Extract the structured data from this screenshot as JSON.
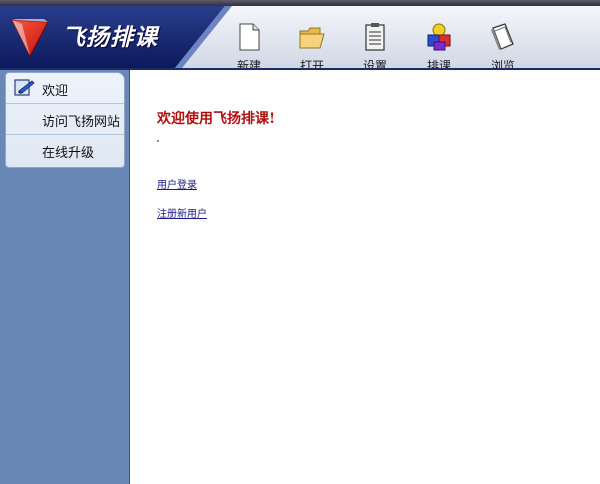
{
  "app": {
    "brand_name": "飞扬排课"
  },
  "toolbar": {
    "buttons": [
      {
        "label": "新建",
        "icon": "new-file-icon"
      },
      {
        "label": "打开",
        "icon": "open-folder-icon"
      },
      {
        "label": "设置",
        "icon": "settings-clipboard-icon"
      },
      {
        "label": "排课",
        "icon": "schedule-blocks-icon"
      },
      {
        "label": "浏览",
        "icon": "browse-book-icon"
      }
    ]
  },
  "sidebar": {
    "items": [
      {
        "label": "欢迎",
        "icon": "welcome-icon"
      },
      {
        "label": "访问飞扬网站"
      },
      {
        "label": "在线升级"
      }
    ]
  },
  "main": {
    "title": "欢迎使用飞扬排课!",
    "links": [
      {
        "label": "用户登录"
      },
      {
        "label": "注册新用户"
      }
    ]
  },
  "colors": {
    "header_navy": "#13246e",
    "sidebar_blue": "#6a88b6",
    "title_red": "#b01010",
    "link_blue": "#1a1a8a"
  }
}
